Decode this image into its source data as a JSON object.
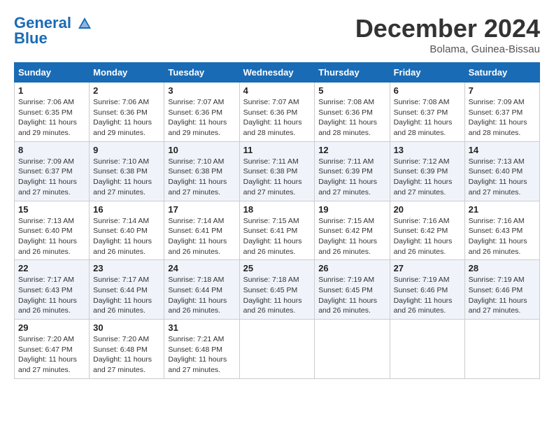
{
  "logo": {
    "line1": "General",
    "line2": "Blue"
  },
  "title": "December 2024",
  "location": "Bolama, Guinea-Bissau",
  "headers": [
    "Sunday",
    "Monday",
    "Tuesday",
    "Wednesday",
    "Thursday",
    "Friday",
    "Saturday"
  ],
  "weeks": [
    [
      {
        "day": "1",
        "sunrise": "7:06 AM",
        "sunset": "6:35 PM",
        "daylight": "11 hours and 29 minutes."
      },
      {
        "day": "2",
        "sunrise": "7:06 AM",
        "sunset": "6:36 PM",
        "daylight": "11 hours and 29 minutes."
      },
      {
        "day": "3",
        "sunrise": "7:07 AM",
        "sunset": "6:36 PM",
        "daylight": "11 hours and 29 minutes."
      },
      {
        "day": "4",
        "sunrise": "7:07 AM",
        "sunset": "6:36 PM",
        "daylight": "11 hours and 28 minutes."
      },
      {
        "day": "5",
        "sunrise": "7:08 AM",
        "sunset": "6:36 PM",
        "daylight": "11 hours and 28 minutes."
      },
      {
        "day": "6",
        "sunrise": "7:08 AM",
        "sunset": "6:37 PM",
        "daylight": "11 hours and 28 minutes."
      },
      {
        "day": "7",
        "sunrise": "7:09 AM",
        "sunset": "6:37 PM",
        "daylight": "11 hours and 28 minutes."
      }
    ],
    [
      {
        "day": "8",
        "sunrise": "7:09 AM",
        "sunset": "6:37 PM",
        "daylight": "11 hours and 27 minutes."
      },
      {
        "day": "9",
        "sunrise": "7:10 AM",
        "sunset": "6:38 PM",
        "daylight": "11 hours and 27 minutes."
      },
      {
        "day": "10",
        "sunrise": "7:10 AM",
        "sunset": "6:38 PM",
        "daylight": "11 hours and 27 minutes."
      },
      {
        "day": "11",
        "sunrise": "7:11 AM",
        "sunset": "6:38 PM",
        "daylight": "11 hours and 27 minutes."
      },
      {
        "day": "12",
        "sunrise": "7:11 AM",
        "sunset": "6:39 PM",
        "daylight": "11 hours and 27 minutes."
      },
      {
        "day": "13",
        "sunrise": "7:12 AM",
        "sunset": "6:39 PM",
        "daylight": "11 hours and 27 minutes."
      },
      {
        "day": "14",
        "sunrise": "7:13 AM",
        "sunset": "6:40 PM",
        "daylight": "11 hours and 27 minutes."
      }
    ],
    [
      {
        "day": "15",
        "sunrise": "7:13 AM",
        "sunset": "6:40 PM",
        "daylight": "11 hours and 26 minutes."
      },
      {
        "day": "16",
        "sunrise": "7:14 AM",
        "sunset": "6:40 PM",
        "daylight": "11 hours and 26 minutes."
      },
      {
        "day": "17",
        "sunrise": "7:14 AM",
        "sunset": "6:41 PM",
        "daylight": "11 hours and 26 minutes."
      },
      {
        "day": "18",
        "sunrise": "7:15 AM",
        "sunset": "6:41 PM",
        "daylight": "11 hours and 26 minutes."
      },
      {
        "day": "19",
        "sunrise": "7:15 AM",
        "sunset": "6:42 PM",
        "daylight": "11 hours and 26 minutes."
      },
      {
        "day": "20",
        "sunrise": "7:16 AM",
        "sunset": "6:42 PM",
        "daylight": "11 hours and 26 minutes."
      },
      {
        "day": "21",
        "sunrise": "7:16 AM",
        "sunset": "6:43 PM",
        "daylight": "11 hours and 26 minutes."
      }
    ],
    [
      {
        "day": "22",
        "sunrise": "7:17 AM",
        "sunset": "6:43 PM",
        "daylight": "11 hours and 26 minutes."
      },
      {
        "day": "23",
        "sunrise": "7:17 AM",
        "sunset": "6:44 PM",
        "daylight": "11 hours and 26 minutes."
      },
      {
        "day": "24",
        "sunrise": "7:18 AM",
        "sunset": "6:44 PM",
        "daylight": "11 hours and 26 minutes."
      },
      {
        "day": "25",
        "sunrise": "7:18 AM",
        "sunset": "6:45 PM",
        "daylight": "11 hours and 26 minutes."
      },
      {
        "day": "26",
        "sunrise": "7:19 AM",
        "sunset": "6:45 PM",
        "daylight": "11 hours and 26 minutes."
      },
      {
        "day": "27",
        "sunrise": "7:19 AM",
        "sunset": "6:46 PM",
        "daylight": "11 hours and 26 minutes."
      },
      {
        "day": "28",
        "sunrise": "7:19 AM",
        "sunset": "6:46 PM",
        "daylight": "11 hours and 27 minutes."
      }
    ],
    [
      {
        "day": "29",
        "sunrise": "7:20 AM",
        "sunset": "6:47 PM",
        "daylight": "11 hours and 27 minutes."
      },
      {
        "day": "30",
        "sunrise": "7:20 AM",
        "sunset": "6:48 PM",
        "daylight": "11 hours and 27 minutes."
      },
      {
        "day": "31",
        "sunrise": "7:21 AM",
        "sunset": "6:48 PM",
        "daylight": "11 hours and 27 minutes."
      },
      null,
      null,
      null,
      null
    ]
  ]
}
